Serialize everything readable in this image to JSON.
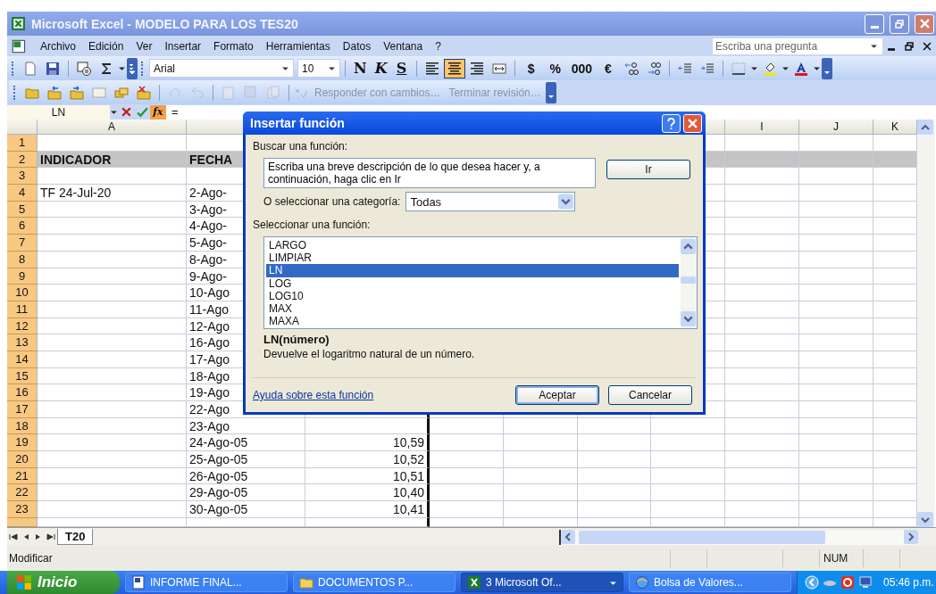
{
  "window": {
    "title": "Microsoft Excel - MODELO PARA LOS TES20"
  },
  "menu": [
    "Archivo",
    "Edición",
    "Ver",
    "Insertar",
    "Formato",
    "Herramientas",
    "Datos",
    "Ventana",
    "?"
  ],
  "help_search": {
    "placeholder": "Escriba una pregunta"
  },
  "formatting": {
    "font": "Arial",
    "size": "10",
    "style_buttons": [
      "N",
      "K",
      "S"
    ],
    "align_buttons": [
      {
        "selected": false
      },
      {
        "selected": true
      },
      {
        "selected": false
      }
    ],
    "number_buttons": [
      "$",
      "%",
      "000",
      "€"
    ]
  },
  "review_toolbar": [
    {
      "label": "Responder con cambios…",
      "disabled": true
    },
    {
      "label": "Terminar revisión…",
      "disabled": true
    }
  ],
  "formula_bar": {
    "name_box": "LN",
    "function_button": "fx",
    "value": "="
  },
  "sheet": {
    "column_headers": [
      "A",
      "I",
      "J",
      "K"
    ],
    "rows": [
      {
        "number": "1",
        "selected": true,
        "kind": "data"
      },
      {
        "number": "2",
        "selected": true,
        "kind": "header",
        "A": "INDICADOR",
        "B": "FECHA"
      },
      {
        "number": "3",
        "selected": true,
        "kind": "data"
      },
      {
        "number": "4",
        "selected": true,
        "kind": "data",
        "A": "TF 24-Jul-20",
        "B": "2-Ago-"
      },
      {
        "number": "5",
        "selected": true,
        "kind": "data",
        "B": "3-Ago-"
      },
      {
        "number": "6",
        "selected": true,
        "kind": "data",
        "B": "4-Ago-"
      },
      {
        "number": "7",
        "selected": true,
        "kind": "data",
        "B": "5-Ago-"
      },
      {
        "number": "8",
        "selected": true,
        "kind": "data",
        "B": "8-Ago-"
      },
      {
        "number": "9",
        "selected": true,
        "kind": "data",
        "B": "9-Ago-"
      },
      {
        "number": "10",
        "selected": true,
        "kind": "data",
        "B": "10-Ago"
      },
      {
        "number": "11",
        "selected": true,
        "kind": "data",
        "B": "11-Ago"
      },
      {
        "number": "12",
        "selected": true,
        "kind": "data",
        "B": "12-Ago"
      },
      {
        "number": "13",
        "selected": true,
        "kind": "data",
        "B": "16-Ago"
      },
      {
        "number": "14",
        "selected": true,
        "kind": "data",
        "B": "17-Ago"
      },
      {
        "number": "15",
        "selected": true,
        "kind": "data",
        "B": "18-Ago"
      },
      {
        "number": "16",
        "selected": true,
        "kind": "data",
        "B": "19-Ago"
      },
      {
        "number": "17",
        "selected": true,
        "kind": "data",
        "B": "22-Ago"
      },
      {
        "number": "18",
        "selected": true,
        "kind": "data",
        "B": "23-Ago"
      },
      {
        "number": "19",
        "selected": true,
        "kind": "data",
        "B": "24-Ago-05",
        "C": "10,59"
      },
      {
        "number": "20",
        "selected": true,
        "kind": "data",
        "B": "25-Ago-05",
        "C": "10,52"
      },
      {
        "number": "21",
        "selected": true,
        "kind": "data",
        "B": "26-Ago-05",
        "C": "10,51"
      },
      {
        "number": "22",
        "selected": true,
        "kind": "data",
        "B": "29-Ago-05",
        "C": "10,40"
      },
      {
        "number": "23",
        "selected": true,
        "kind": "data",
        "B": "30-Ago-05",
        "C": "10,41"
      }
    ],
    "tabs": [
      {
        "label": "T20",
        "selected": true
      }
    ]
  },
  "dialog": {
    "title": "Insertar función",
    "search_label": "Buscar una función:",
    "search_value": "Escriba una breve descripción de lo que desea hacer y, a continuación, haga clic en Ir",
    "go_button": "Ir",
    "category_label": "O seleccionar una categoría:",
    "category_value": "Todas",
    "function_label": "Seleccionar una función:",
    "functions": [
      {
        "name": "LARGO",
        "selected": false
      },
      {
        "name": "LIMPIAR",
        "selected": false
      },
      {
        "name": "LN",
        "selected": true
      },
      {
        "name": "LOG",
        "selected": false
      },
      {
        "name": "LOG10",
        "selected": false
      },
      {
        "name": "MAX",
        "selected": false
      },
      {
        "name": "MAXA",
        "selected": false
      }
    ],
    "signature": "LN(número)",
    "description": "Devuelve el logaritmo natural de un número.",
    "help_link": "Ayuda sobre esta función",
    "buttons": [
      {
        "label": "Aceptar",
        "default": true
      },
      {
        "label": "Cancelar",
        "default": false
      }
    ]
  },
  "status_bar": {
    "mode": "Modificar",
    "indicator": "NUM"
  },
  "taskbar": {
    "start": "Inicio",
    "tasks": [
      {
        "label": "INFORME FINAL...",
        "selected": false,
        "kind": "document"
      },
      {
        "label": "DOCUMENTOS P...",
        "selected": false,
        "kind": "folder"
      },
      {
        "label": "3 Microsoft Of...",
        "selected": true,
        "kind": "excel"
      },
      {
        "label": "Bolsa de Valores...",
        "selected": false,
        "kind": "browser"
      }
    ],
    "time": "05:46 p.m."
  }
}
